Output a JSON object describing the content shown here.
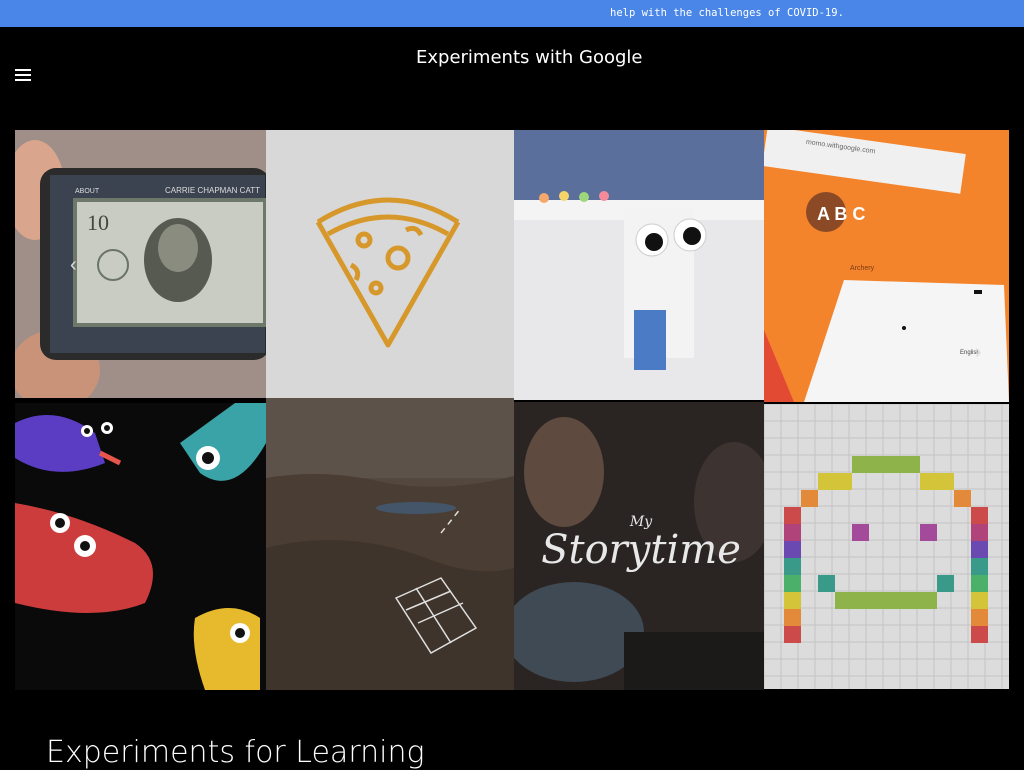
{
  "topbar": {
    "notice": "help with the challenges of COVID-19."
  },
  "header": {
    "brand": "Experiments with Google",
    "menu_icon": "hamburger-menu-icon"
  },
  "tiles": {
    "money": {
      "label_about": "ABOUT",
      "name_on_bill": "CARRIE CHAPMAN CATT"
    },
    "alphabet": {
      "letters": "A B C",
      "caption": "Archery",
      "url": "momo.withgoogle.com",
      "lang": "English"
    },
    "storytime": {
      "title": "Storytime",
      "prefix": "My"
    }
  },
  "section": {
    "title": "Experiments for Learning"
  },
  "colors": {
    "topbar": "#4a86e8",
    "background": "#000000",
    "alphabet_orange": "#f4842b"
  }
}
